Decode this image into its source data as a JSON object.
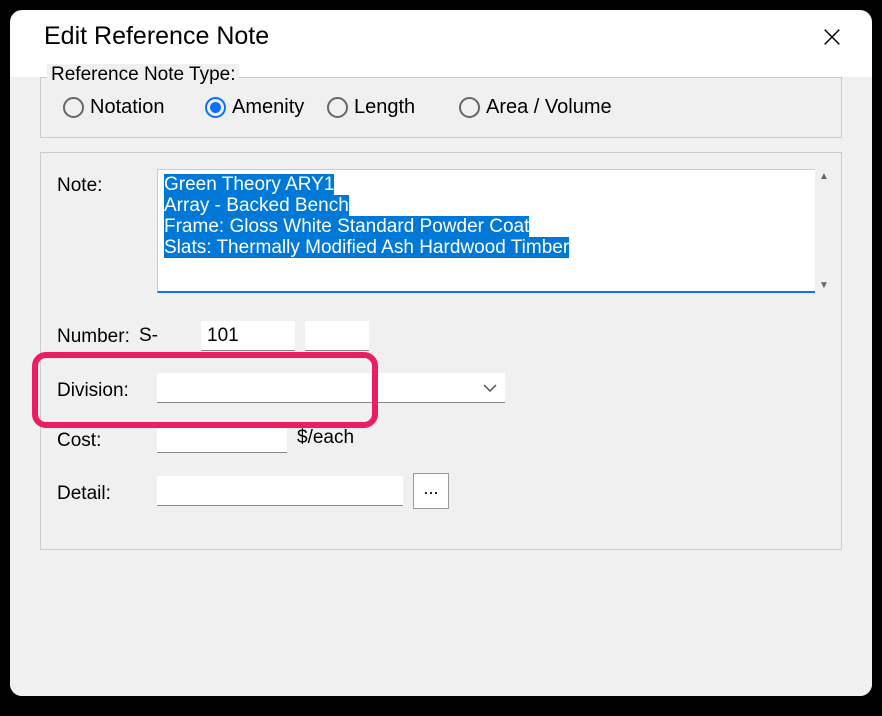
{
  "window": {
    "title": "Edit Reference Note"
  },
  "reference_type": {
    "legend": "Reference Note Type:",
    "options": [
      {
        "label": "Notation",
        "selected": false
      },
      {
        "label": "Amenity",
        "selected": true
      },
      {
        "label": "Length",
        "selected": false
      },
      {
        "label": "Area / Volume",
        "selected": false
      }
    ]
  },
  "form": {
    "note_label": "Note:",
    "note_lines": [
      "Green Theory ARY1",
      "Array - Backed Bench",
      "Frame: Gloss White Standard Powder Coat",
      "Slats: Thermally Modified Ash Hardwood Timber"
    ],
    "number_label": "Number:",
    "number_prefix": "S-",
    "number_value": "101",
    "number_suffix": "",
    "division_label": "Division:",
    "division_value": "",
    "cost_label": "Cost:",
    "cost_value": "",
    "cost_unit": "$/each",
    "detail_label": "Detail:",
    "detail_value": "",
    "browse_label": "..."
  }
}
